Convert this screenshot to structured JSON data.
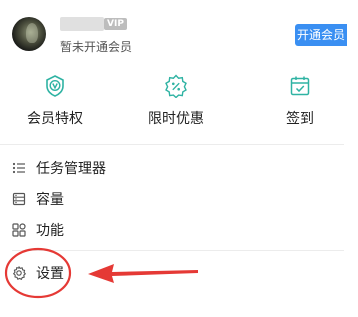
{
  "profile": {
    "vip_badge": "VIP",
    "member_status": "暂未开通会员",
    "open_vip_label": "开通会员"
  },
  "quick_actions": [
    {
      "label": "会员特权",
      "icon": "v-shield-icon"
    },
    {
      "label": "限时优惠",
      "icon": "discount-badge-icon"
    },
    {
      "label": "签到",
      "icon": "calendar-check-icon"
    }
  ],
  "menu": [
    {
      "label": "任务管理器",
      "icon": "task-list-icon"
    },
    {
      "label": "容量",
      "icon": "storage-icon"
    },
    {
      "label": "功能",
      "icon": "grid-icon"
    },
    {
      "label": "设置",
      "icon": "gear-icon"
    }
  ],
  "colors": {
    "accent": "#3a8ff2",
    "icon_teal": "#2fb3a3",
    "annotation_red": "#e53935"
  }
}
